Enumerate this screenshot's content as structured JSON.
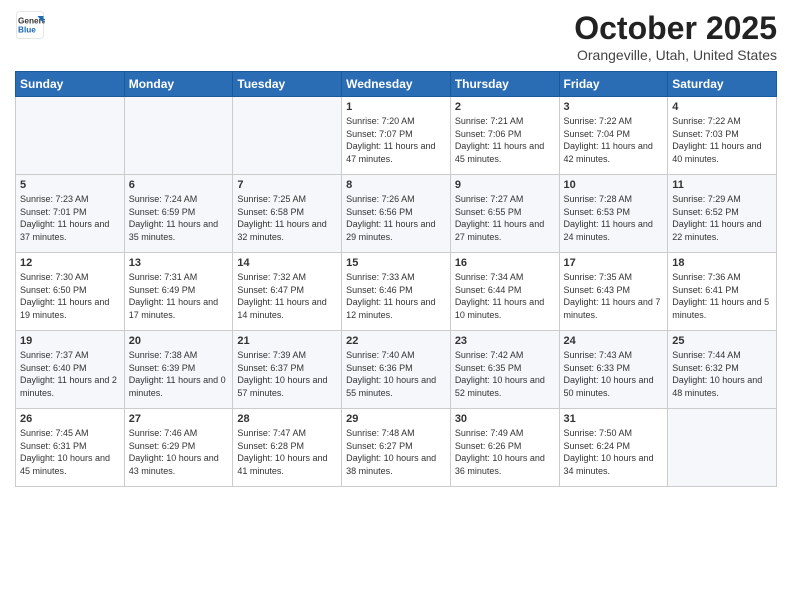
{
  "header": {
    "logo_general": "General",
    "logo_blue": "Blue",
    "month": "October 2025",
    "location": "Orangeville, Utah, United States"
  },
  "days_of_week": [
    "Sunday",
    "Monday",
    "Tuesday",
    "Wednesday",
    "Thursday",
    "Friday",
    "Saturday"
  ],
  "weeks": [
    [
      {
        "day": "",
        "info": ""
      },
      {
        "day": "",
        "info": ""
      },
      {
        "day": "",
        "info": ""
      },
      {
        "day": "1",
        "info": "Sunrise: 7:20 AM\nSunset: 7:07 PM\nDaylight: 11 hours\nand 47 minutes."
      },
      {
        "day": "2",
        "info": "Sunrise: 7:21 AM\nSunset: 7:06 PM\nDaylight: 11 hours\nand 45 minutes."
      },
      {
        "day": "3",
        "info": "Sunrise: 7:22 AM\nSunset: 7:04 PM\nDaylight: 11 hours\nand 42 minutes."
      },
      {
        "day": "4",
        "info": "Sunrise: 7:22 AM\nSunset: 7:03 PM\nDaylight: 11 hours\nand 40 minutes."
      }
    ],
    [
      {
        "day": "5",
        "info": "Sunrise: 7:23 AM\nSunset: 7:01 PM\nDaylight: 11 hours\nand 37 minutes."
      },
      {
        "day": "6",
        "info": "Sunrise: 7:24 AM\nSunset: 6:59 PM\nDaylight: 11 hours\nand 35 minutes."
      },
      {
        "day": "7",
        "info": "Sunrise: 7:25 AM\nSunset: 6:58 PM\nDaylight: 11 hours\nand 32 minutes."
      },
      {
        "day": "8",
        "info": "Sunrise: 7:26 AM\nSunset: 6:56 PM\nDaylight: 11 hours\nand 29 minutes."
      },
      {
        "day": "9",
        "info": "Sunrise: 7:27 AM\nSunset: 6:55 PM\nDaylight: 11 hours\nand 27 minutes."
      },
      {
        "day": "10",
        "info": "Sunrise: 7:28 AM\nSunset: 6:53 PM\nDaylight: 11 hours\nand 24 minutes."
      },
      {
        "day": "11",
        "info": "Sunrise: 7:29 AM\nSunset: 6:52 PM\nDaylight: 11 hours\nand 22 minutes."
      }
    ],
    [
      {
        "day": "12",
        "info": "Sunrise: 7:30 AM\nSunset: 6:50 PM\nDaylight: 11 hours\nand 19 minutes."
      },
      {
        "day": "13",
        "info": "Sunrise: 7:31 AM\nSunset: 6:49 PM\nDaylight: 11 hours\nand 17 minutes."
      },
      {
        "day": "14",
        "info": "Sunrise: 7:32 AM\nSunset: 6:47 PM\nDaylight: 11 hours\nand 14 minutes."
      },
      {
        "day": "15",
        "info": "Sunrise: 7:33 AM\nSunset: 6:46 PM\nDaylight: 11 hours\nand 12 minutes."
      },
      {
        "day": "16",
        "info": "Sunrise: 7:34 AM\nSunset: 6:44 PM\nDaylight: 11 hours\nand 10 minutes."
      },
      {
        "day": "17",
        "info": "Sunrise: 7:35 AM\nSunset: 6:43 PM\nDaylight: 11 hours\nand 7 minutes."
      },
      {
        "day": "18",
        "info": "Sunrise: 7:36 AM\nSunset: 6:41 PM\nDaylight: 11 hours\nand 5 minutes."
      }
    ],
    [
      {
        "day": "19",
        "info": "Sunrise: 7:37 AM\nSunset: 6:40 PM\nDaylight: 11 hours\nand 2 minutes."
      },
      {
        "day": "20",
        "info": "Sunrise: 7:38 AM\nSunset: 6:39 PM\nDaylight: 11 hours\nand 0 minutes."
      },
      {
        "day": "21",
        "info": "Sunrise: 7:39 AM\nSunset: 6:37 PM\nDaylight: 10 hours\nand 57 minutes."
      },
      {
        "day": "22",
        "info": "Sunrise: 7:40 AM\nSunset: 6:36 PM\nDaylight: 10 hours\nand 55 minutes."
      },
      {
        "day": "23",
        "info": "Sunrise: 7:42 AM\nSunset: 6:35 PM\nDaylight: 10 hours\nand 52 minutes."
      },
      {
        "day": "24",
        "info": "Sunrise: 7:43 AM\nSunset: 6:33 PM\nDaylight: 10 hours\nand 50 minutes."
      },
      {
        "day": "25",
        "info": "Sunrise: 7:44 AM\nSunset: 6:32 PM\nDaylight: 10 hours\nand 48 minutes."
      }
    ],
    [
      {
        "day": "26",
        "info": "Sunrise: 7:45 AM\nSunset: 6:31 PM\nDaylight: 10 hours\nand 45 minutes."
      },
      {
        "day": "27",
        "info": "Sunrise: 7:46 AM\nSunset: 6:29 PM\nDaylight: 10 hours\nand 43 minutes."
      },
      {
        "day": "28",
        "info": "Sunrise: 7:47 AM\nSunset: 6:28 PM\nDaylight: 10 hours\nand 41 minutes."
      },
      {
        "day": "29",
        "info": "Sunrise: 7:48 AM\nSunset: 6:27 PM\nDaylight: 10 hours\nand 38 minutes."
      },
      {
        "day": "30",
        "info": "Sunrise: 7:49 AM\nSunset: 6:26 PM\nDaylight: 10 hours\nand 36 minutes."
      },
      {
        "day": "31",
        "info": "Sunrise: 7:50 AM\nSunset: 6:24 PM\nDaylight: 10 hours\nand 34 minutes."
      },
      {
        "day": "",
        "info": ""
      }
    ]
  ]
}
